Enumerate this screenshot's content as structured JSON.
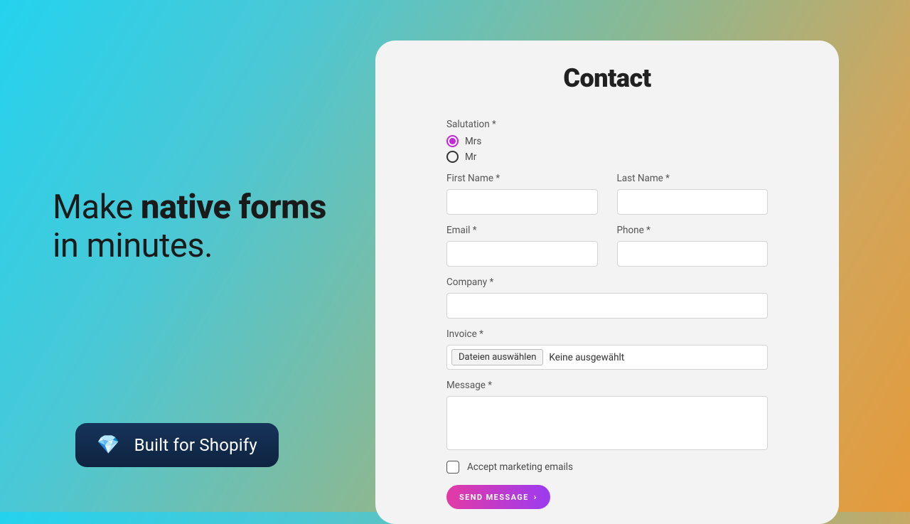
{
  "headline": {
    "part1": "Make ",
    "bold1": "native forms",
    "part2": " in minutes."
  },
  "badge": {
    "icon": "💎",
    "label": "Built for Shopify"
  },
  "form": {
    "title": "Contact",
    "salutation_label": "Salutation *",
    "radio_mrs": "Mrs",
    "radio_mr": "Mr",
    "first_name_label": "First Name *",
    "last_name_label": "Last Name *",
    "email_label": "Email *",
    "phone_label": "Phone *",
    "company_label": "Company *",
    "invoice_label": "Invoice *",
    "file_button": "Dateien auswählen",
    "file_status": "Keine ausgewählt",
    "message_label": "Message *",
    "accept_label": "Accept marketing emails",
    "send_label": "Send Message",
    "send_chevron": "›"
  }
}
